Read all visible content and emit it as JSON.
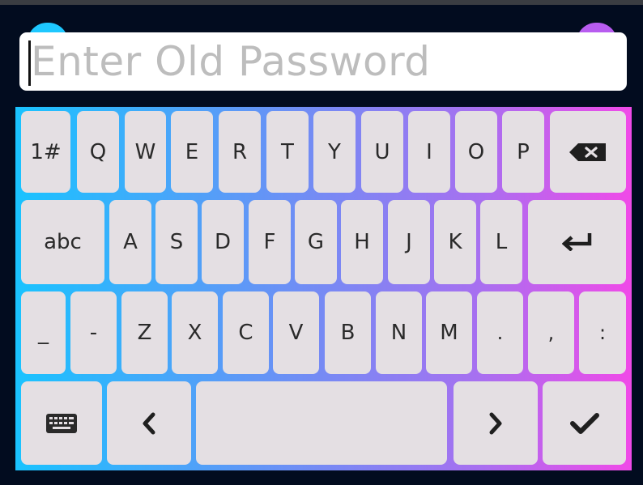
{
  "input": {
    "placeholder": "Enter Old Password",
    "value": ""
  },
  "keyboard": {
    "rows": [
      [
        {
          "label": "1#",
          "name": "key-symbols"
        },
        {
          "label": "Q",
          "name": "key-q"
        },
        {
          "label": "W",
          "name": "key-w"
        },
        {
          "label": "E",
          "name": "key-e"
        },
        {
          "label": "R",
          "name": "key-r"
        },
        {
          "label": "T",
          "name": "key-t"
        },
        {
          "label": "Y",
          "name": "key-y"
        },
        {
          "label": "U",
          "name": "key-u"
        },
        {
          "label": "I",
          "name": "key-i"
        },
        {
          "label": "O",
          "name": "key-o"
        },
        {
          "label": "P",
          "name": "key-p"
        },
        {
          "label": "",
          "name": "key-backspace",
          "icon": "backspace-icon"
        }
      ],
      [
        {
          "label": "abc",
          "name": "key-abc"
        },
        {
          "label": "A",
          "name": "key-a"
        },
        {
          "label": "S",
          "name": "key-s"
        },
        {
          "label": "D",
          "name": "key-d"
        },
        {
          "label": "F",
          "name": "key-f"
        },
        {
          "label": "G",
          "name": "key-g"
        },
        {
          "label": "H",
          "name": "key-h"
        },
        {
          "label": "J",
          "name": "key-j"
        },
        {
          "label": "K",
          "name": "key-k"
        },
        {
          "label": "L",
          "name": "key-l"
        },
        {
          "label": "",
          "name": "key-enter",
          "icon": "enter-icon"
        }
      ],
      [
        {
          "label": "_",
          "name": "key-underscore"
        },
        {
          "label": "-",
          "name": "key-dash"
        },
        {
          "label": "Z",
          "name": "key-z"
        },
        {
          "label": "X",
          "name": "key-x"
        },
        {
          "label": "C",
          "name": "key-c"
        },
        {
          "label": "V",
          "name": "key-v"
        },
        {
          "label": "B",
          "name": "key-b"
        },
        {
          "label": "N",
          "name": "key-n"
        },
        {
          "label": "M",
          "name": "key-m"
        },
        {
          "label": ".",
          "name": "key-period"
        },
        {
          "label": ",",
          "name": "key-comma"
        },
        {
          "label": ":",
          "name": "key-colon"
        }
      ],
      [
        {
          "label": "",
          "name": "key-keyboard-toggle",
          "icon": "keyboard-icon"
        },
        {
          "label": "",
          "name": "key-left",
          "icon": "chevron-left-icon"
        },
        {
          "label": "",
          "name": "key-space"
        },
        {
          "label": "",
          "name": "key-right",
          "icon": "chevron-right-icon"
        },
        {
          "label": "",
          "name": "key-ok",
          "icon": "checkmark-icon"
        }
      ]
    ]
  },
  "colors": {
    "background": "#020c1f",
    "key_fill": "#e4dfe3",
    "gradient_start": "#19c3ff",
    "gradient_end": "#f04ae8",
    "placeholder_text": "#bdbdbd"
  }
}
